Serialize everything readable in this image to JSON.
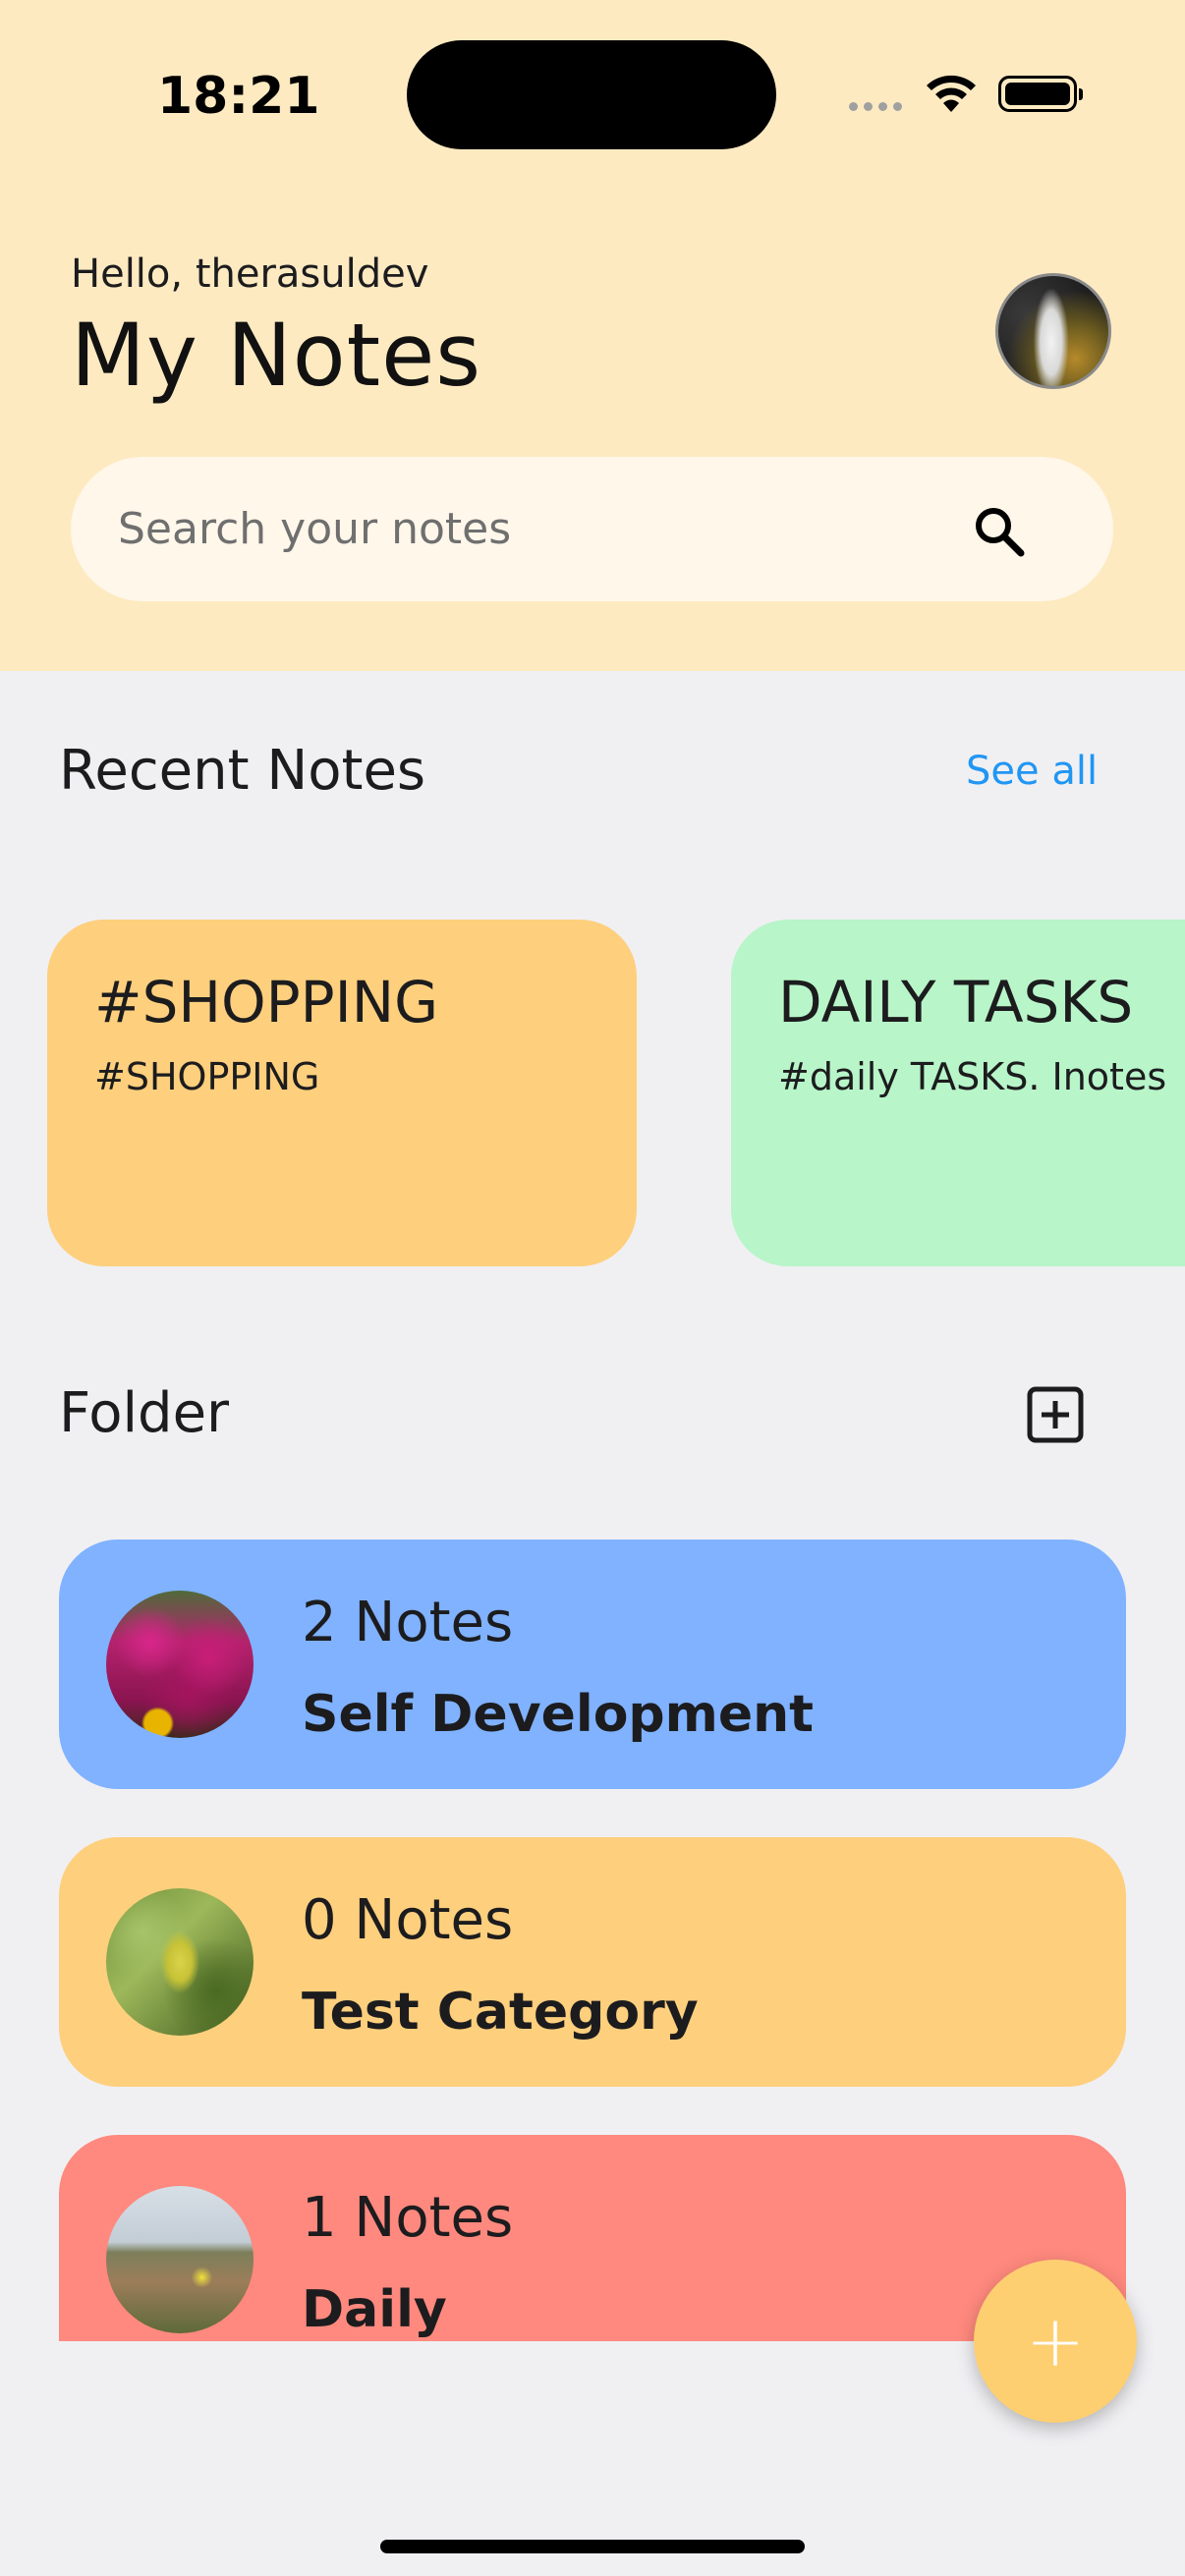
{
  "status_bar": {
    "time": "18:21"
  },
  "header": {
    "greeting": "Hello, therasuldev",
    "title": "My Notes"
  },
  "search": {
    "placeholder": "Search your notes",
    "icon": "search-icon"
  },
  "recent": {
    "title": "Recent Notes",
    "see_all": "See all",
    "notes": [
      {
        "title": "#SHOPPING",
        "body": "#SHOPPING",
        "color": "#fecf7d"
      },
      {
        "title": "DAILY TASKS",
        "body": "#daily TASKS. Inotes",
        "color": "#b8f5c9"
      }
    ]
  },
  "folders": {
    "title": "Folder",
    "add_icon": "add-box-icon",
    "items": [
      {
        "count": "2 Notes",
        "name": "Self Development",
        "color": "#80b2ff"
      },
      {
        "count": "0 Notes",
        "name": "Test Category",
        "color": "#fecf7d"
      },
      {
        "count": "1 Notes",
        "name": "Daily",
        "color": "#ff897e"
      }
    ]
  },
  "fab": {
    "label": "+"
  },
  "colors": {
    "header_bg": "#feeac1",
    "page_bg": "#f0f0f3",
    "link": "#2196f3",
    "fab": "#fecf70"
  }
}
